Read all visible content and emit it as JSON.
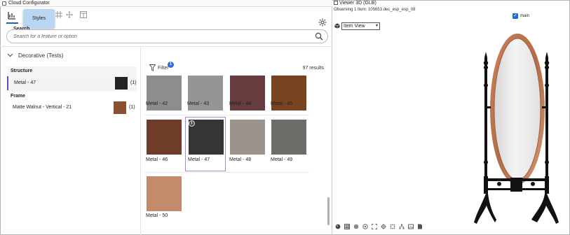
{
  "left_panel": {
    "title": "Cloud Configurator",
    "tooltip": "Styles",
    "search": {
      "label": "Search",
      "placeholder": "Search for a feature or option"
    },
    "group_label": "Decorative (Tests)",
    "structure": {
      "title": "Structure",
      "name": "Metal - 47",
      "count": "(1)",
      "swatch": "#232323"
    },
    "frame": {
      "title": "Frame",
      "name": "Matte Walnut - Vertical - 21",
      "count": "(1)",
      "swatch": "#8a5030"
    },
    "filter": {
      "label": "Filter",
      "badge": "1"
    },
    "results": "97 results",
    "tiles": [
      {
        "name": "Metal - 42",
        "color": "#8d8d8d"
      },
      {
        "name": "Metal - 43",
        "color": "#959595"
      },
      {
        "name": "Metal - 44",
        "color": "#663c3e"
      },
      {
        "name": "Metal - 45",
        "color": "#78431f"
      },
      {
        "name": "Metal - 46",
        "color": "#6e3c28"
      },
      {
        "name": "Metal - 47",
        "color": "#353535",
        "selected": true
      },
      {
        "name": "Metal - 48",
        "color": "#9c938d"
      },
      {
        "name": "Metal - 49",
        "color": "#6e6c66"
      },
      {
        "name": "Metal - 50",
        "color": "#c38a6c"
      }
    ]
  },
  "right_panel": {
    "title": "Viewer 3D (GLB)",
    "observing": "Observing 1 Item: 105653.dec_esp_esp_08",
    "main_label": "main",
    "view_select": "Item View"
  }
}
